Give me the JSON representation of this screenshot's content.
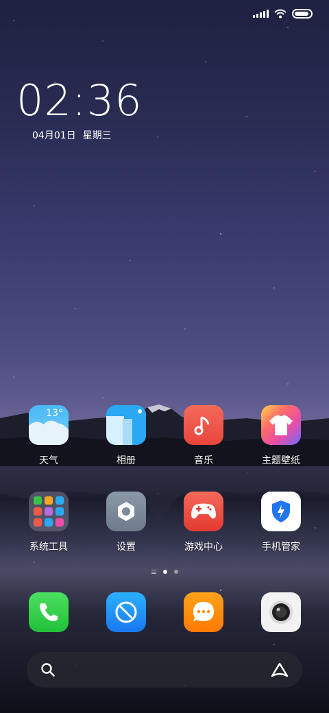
{
  "status_bar": {
    "signal_icon": "cellular-signal-icon",
    "wifi_icon": "wifi-icon",
    "battery_icon": "battery-icon",
    "battery_level": 0.9
  },
  "lockclock": {
    "time": "02:36",
    "date": "04月01日",
    "weekday": "星期三"
  },
  "apps": [
    {
      "label": "天气",
      "icon": "weather-icon",
      "temp": "13°"
    },
    {
      "label": "相册",
      "icon": "gallery-icon"
    },
    {
      "label": "音乐",
      "icon": "music-icon"
    },
    {
      "label": "主题壁纸",
      "icon": "themes-icon"
    },
    {
      "label": "系统工具",
      "icon": "folder-icon"
    },
    {
      "label": "设置",
      "icon": "settings-icon"
    },
    {
      "label": "游戏中心",
      "icon": "game-center-icon"
    },
    {
      "label": "手机管家",
      "icon": "security-icon"
    }
  ],
  "page_indicator": {
    "pages": 2,
    "active_page": 1
  },
  "dock": [
    {
      "icon": "phone-icon"
    },
    {
      "icon": "browser-icon"
    },
    {
      "icon": "messages-icon"
    },
    {
      "icon": "camera-icon"
    }
  ],
  "search": {
    "search_icon": "search-icon",
    "assistant_icon": "assistant-icon"
  },
  "colors": {
    "phone": "#2ecc40",
    "browser": "#1a8cff",
    "messages": "#ff8c00",
    "music": "#f24c4c",
    "games": "#e8453c",
    "settings": "#7c8a9a"
  }
}
